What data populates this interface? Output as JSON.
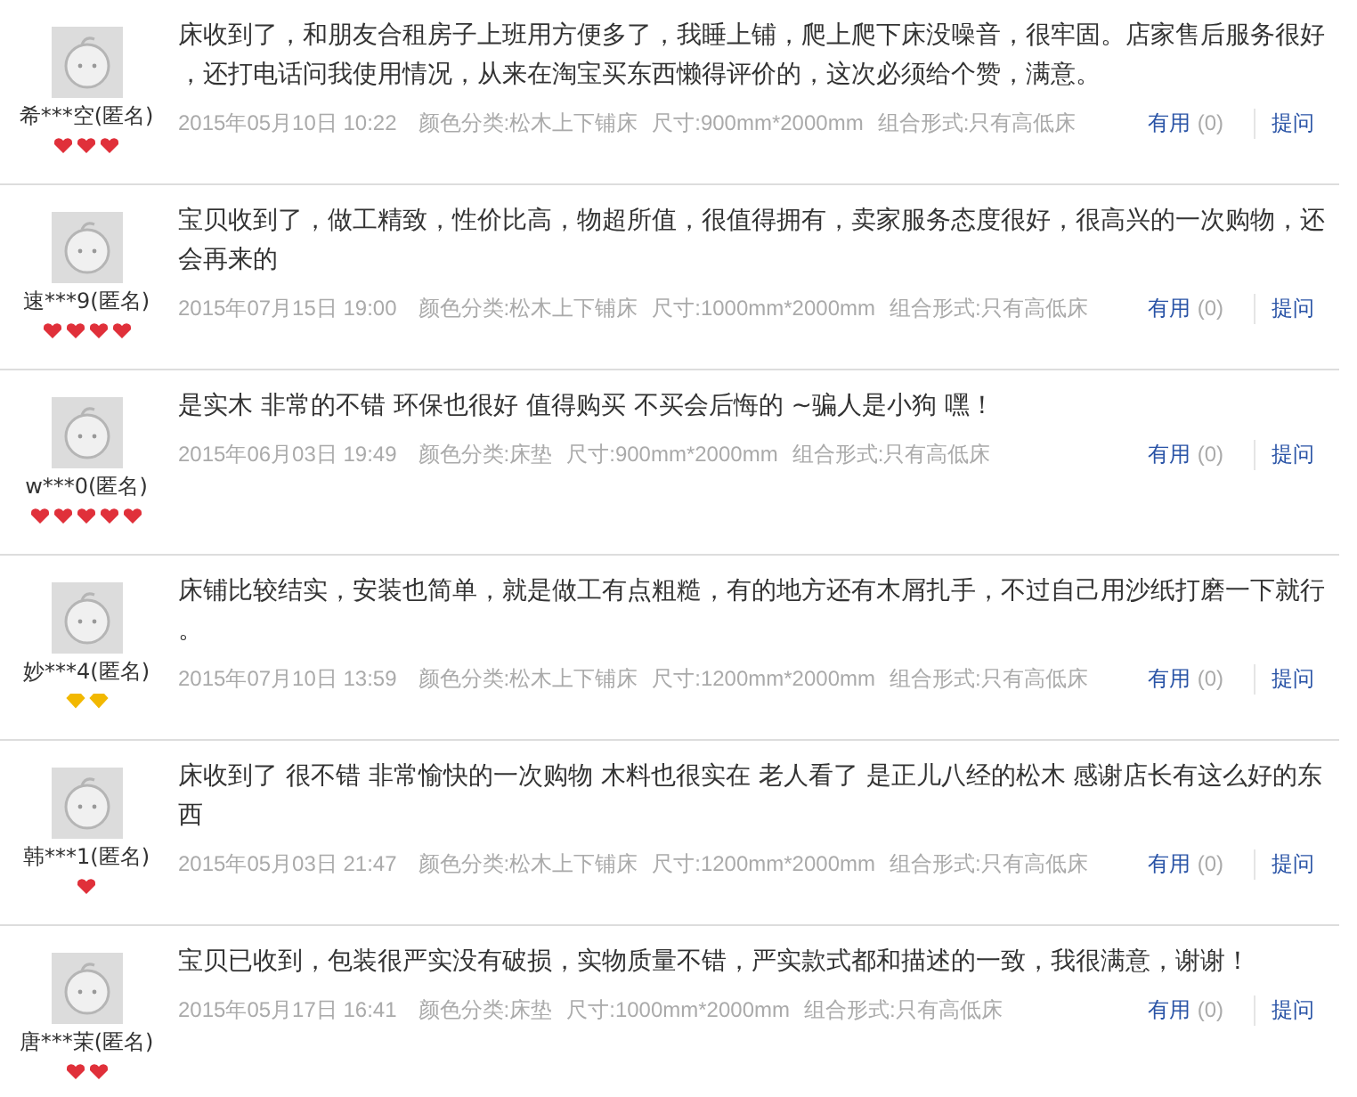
{
  "reviews": [
    {
      "user": "希***空(匿名)",
      "rank_icons": [
        {
          "kind": "heart"
        },
        {
          "kind": "heart"
        },
        {
          "kind": "heart"
        }
      ],
      "text": "床收到了，和朋友合租房子上班用方便多了，我睡上铺，爬上爬下床没噪音，很牢固。店家售后服务很好，还打电话问我使用情况，从来在淘宝买东西懒得评价的，这次必须给个赞，满意。",
      "date": "2015年05月10日 10:22",
      "color_category": "颜色分类:松木上下铺床",
      "size": "尺寸:900mm*2000mm",
      "combo": "组合形式:只有高低床",
      "useful": "有用",
      "useful_count": "(0)",
      "ask": "提问"
    },
    {
      "user": "速***9(匿名)",
      "rank_icons": [
        {
          "kind": "heart"
        },
        {
          "kind": "heart"
        },
        {
          "kind": "heart"
        },
        {
          "kind": "heart"
        }
      ],
      "text": "宝贝收到了，做工精致，性价比高，物超所值，很值得拥有，卖家服务态度很好，很高兴的一次购物，还会再来的",
      "date": "2015年07月15日 19:00",
      "color_category": "颜色分类:松木上下铺床",
      "size": "尺寸:1000mm*2000mm",
      "combo": "组合形式:只有高低床",
      "useful": "有用",
      "useful_count": "(0)",
      "ask": "提问"
    },
    {
      "user": "w***0(匿名)",
      "rank_icons": [
        {
          "kind": "heart"
        },
        {
          "kind": "heart"
        },
        {
          "kind": "heart"
        },
        {
          "kind": "heart"
        },
        {
          "kind": "heart"
        }
      ],
      "text": "是实木 非常的不错 环保也很好 值得购买 不买会后悔的 ~骗人是小狗 嘿！",
      "date": "2015年06月03日 19:49",
      "color_category": "颜色分类:床垫",
      "size": "尺寸:900mm*2000mm",
      "combo": "组合形式:只有高低床",
      "useful": "有用",
      "useful_count": "(0)",
      "ask": "提问"
    },
    {
      "user": "妙***4(匿名)",
      "rank_icons": [
        {
          "kind": "diamond"
        },
        {
          "kind": "diamond"
        }
      ],
      "text": "床铺比较结实，安装也简单，就是做工有点粗糙，有的地方还有木屑扎手，不过自己用沙纸打磨一下就行。",
      "date": "2015年07月10日 13:59",
      "color_category": "颜色分类:松木上下铺床",
      "size": "尺寸:1200mm*2000mm",
      "combo": "组合形式:只有高低床",
      "useful": "有用",
      "useful_count": "(0)",
      "ask": "提问"
    },
    {
      "user": "韩***1(匿名)",
      "rank_icons": [
        {
          "kind": "heart"
        }
      ],
      "text": "床收到了 很不错 非常愉快的一次购物 木料也很实在 老人看了 是正儿八经的松木 感谢店长有这么好的东西",
      "date": "2015年05月03日 21:47",
      "color_category": "颜色分类:松木上下铺床",
      "size": "尺寸:1200mm*2000mm",
      "combo": "组合形式:只有高低床",
      "useful": "有用",
      "useful_count": "(0)",
      "ask": "提问"
    },
    {
      "user": "唐***茉(匿名)",
      "rank_icons": [
        {
          "kind": "heart"
        },
        {
          "kind": "heart"
        }
      ],
      "text": "宝贝已收到，包装很严实没有破损，实物质量不错，严实款式都和描述的一致，我很满意，谢谢！",
      "date": "2015年05月17日 16:41",
      "color_category": "颜色分类:床垫",
      "size": "尺寸:1000mm*2000mm",
      "combo": "组合形式:只有高低床",
      "useful": "有用",
      "useful_count": "(0)",
      "ask": "提问"
    }
  ]
}
